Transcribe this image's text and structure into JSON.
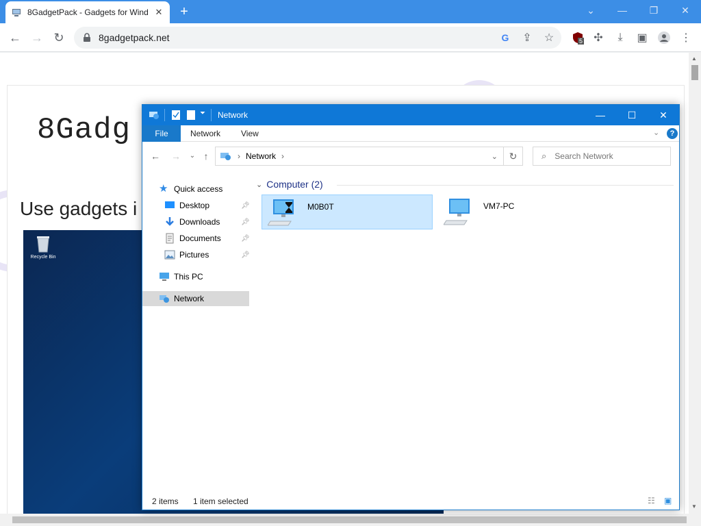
{
  "browser": {
    "tab_title": "8GadgetPack - Gadgets for Wind",
    "url": "8gadgetpack.net",
    "extension_badge": "5",
    "accent": "#3c8ee6"
  },
  "webpage": {
    "site_title": "8Gadg",
    "subtitle": "Use gadgets i",
    "recycle_bin_label": "Recycle Bin"
  },
  "explorer": {
    "window_title": "Network",
    "ribbon_tabs": [
      "File",
      "Network",
      "View"
    ],
    "address_crumb": "Network",
    "search_placeholder": "Search Network",
    "nav": {
      "quick_access": "Quick access",
      "desktop": "Desktop",
      "downloads": "Downloads",
      "documents": "Documents",
      "pictures": "Pictures",
      "this_pc": "This PC",
      "network": "Network"
    },
    "group_header": "Computer (2)",
    "computers": [
      {
        "name": "M0B0T",
        "selected": true
      },
      {
        "name": "VM7-PC",
        "selected": false
      }
    ],
    "status": {
      "items": "2 items",
      "selected": "1 item selected"
    }
  }
}
